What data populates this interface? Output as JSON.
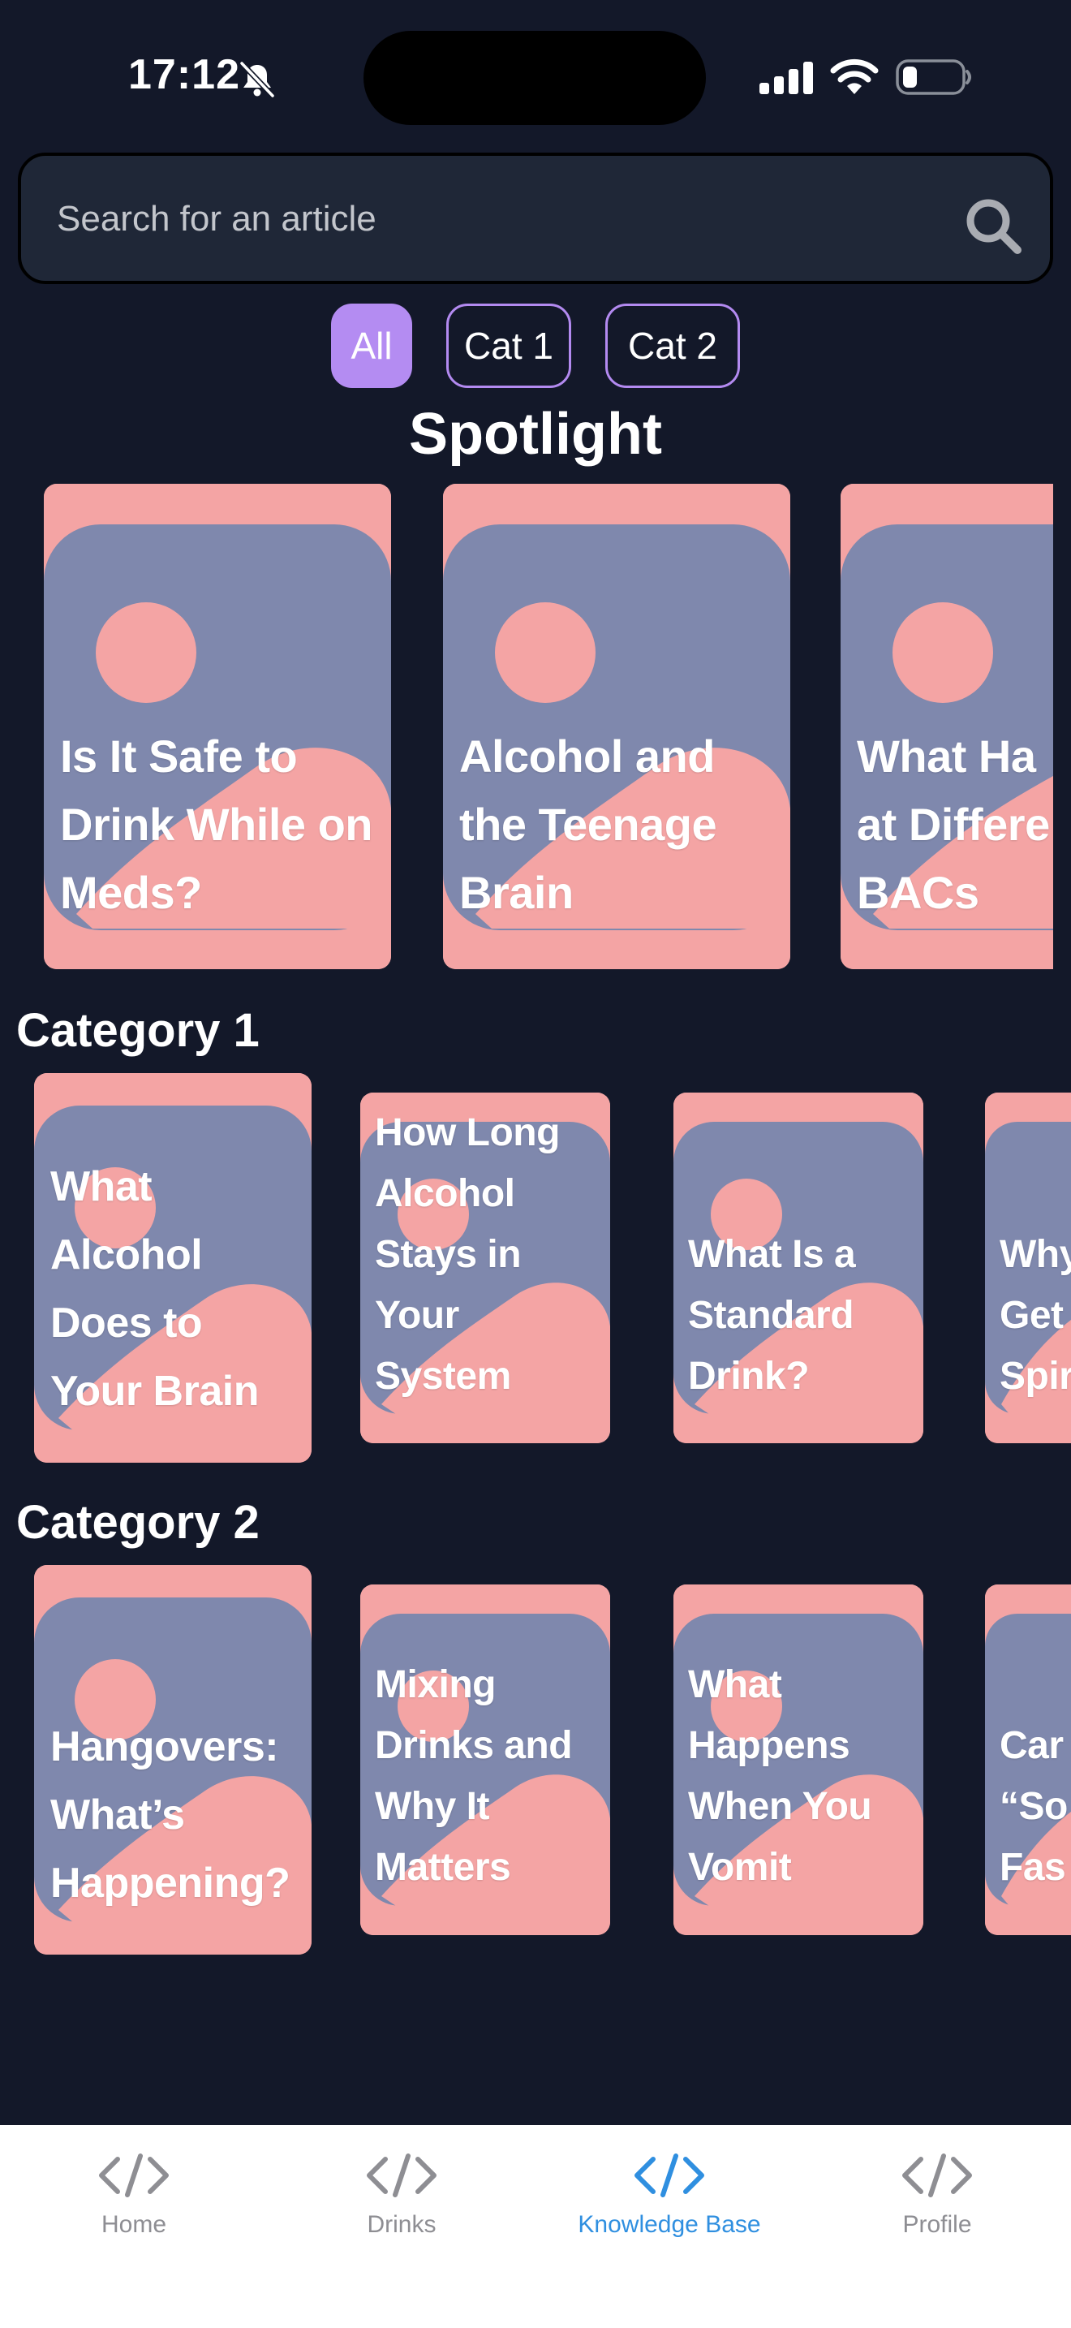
{
  "status_bar": {
    "time": "17:12",
    "icons": [
      "bell-slash-icon",
      "signal-icon",
      "wifi-icon",
      "battery-icon"
    ]
  },
  "search": {
    "placeholder": "Search for an article",
    "icon": "search-icon"
  },
  "filters": {
    "chips": [
      {
        "label": "All",
        "active": true
      },
      {
        "label": "Cat 1",
        "active": false
      },
      {
        "label": "Cat 2",
        "active": false
      }
    ]
  },
  "spotlight": {
    "title": "Spotlight",
    "cards": [
      {
        "title": "Is It Safe to Drink While on Meds?",
        "lines": [
          "Is It Safe to",
          "Drink While on",
          "Meds?"
        ]
      },
      {
        "title": "Alcohol and the Teenage Brain",
        "lines": [
          "Alcohol and",
          "the Teenage",
          "Brain"
        ]
      },
      {
        "title": "What Happens at Different BACs",
        "lines": [
          "What Ha",
          "at Differe",
          "BACs"
        ]
      }
    ]
  },
  "category1": {
    "title": "Category 1",
    "cards": [
      {
        "title": "What Alcohol Does to Your Brain",
        "lines": [
          "What",
          "Alcohol",
          "Does to",
          "Your Brain"
        ]
      },
      {
        "title": "How Long Alcohol Stays in Your System",
        "lines": [
          "How Long",
          "Alcohol",
          "Stays in",
          "Your",
          "System"
        ]
      },
      {
        "title": "What Is a Standard Drink?",
        "lines": [
          "What Is a",
          "Standard",
          "Drink?"
        ]
      },
      {
        "title": "Why ... Get ... Spir...",
        "lines": [
          "Why",
          "Get",
          "Spir"
        ]
      }
    ]
  },
  "category2": {
    "title": "Category 2",
    "cards": [
      {
        "title": "Hangovers: What’s Happening?",
        "lines": [
          "Hangovers:",
          "What’s",
          "Happening?"
        ]
      },
      {
        "title": "Mixing Drinks and Why It Matters",
        "lines": [
          "Mixing",
          "Drinks and",
          "Why It",
          "Matters"
        ]
      },
      {
        "title": "What Happens When You Vomit",
        "lines": [
          "What",
          "Happens",
          "When You",
          "Vomit"
        ]
      },
      {
        "title": "Can ... “So... Fas...",
        "lines": [
          "Car",
          "“So",
          "Fas"
        ]
      }
    ]
  },
  "tab_bar": {
    "tabs": [
      {
        "label": "Home",
        "icon": "code-icon",
        "active": false
      },
      {
        "label": "Drinks",
        "icon": "code-icon",
        "active": false
      },
      {
        "label": "Knowledge Base",
        "icon": "code-icon",
        "active": true
      },
      {
        "label": "Profile",
        "icon": "code-icon",
        "active": false
      }
    ]
  },
  "colors": {
    "background": "#131829",
    "search_bg": "#1f2737",
    "chip_accent": "#b48cf2",
    "card_pink": "#f4a4a4",
    "card_slate": "#7f88ad",
    "tab_active": "#2f8fe0",
    "tab_inactive": "#8e8e93"
  }
}
